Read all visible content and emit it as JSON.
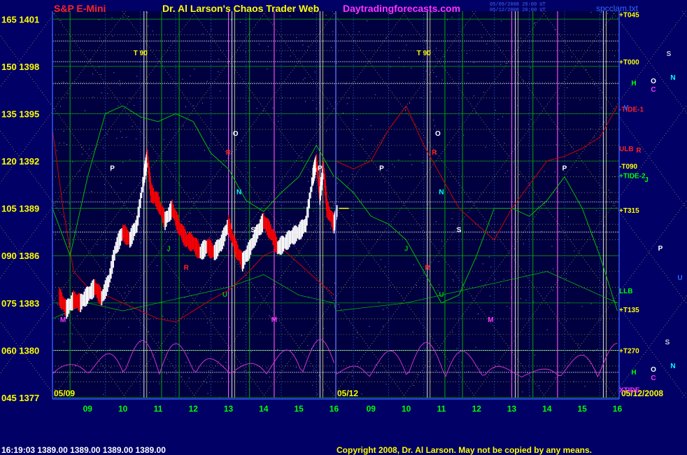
{
  "header": {
    "instrument": "S&P E-Mini",
    "title": "Dr. Al Larson's Chaos Trader Web",
    "site": "Daytradingforecasts.com",
    "timestamp_1": "05/09/2008 20:00 UT",
    "timestamp_2": "05/12/2008 20:00 UT",
    "file": "spcclam.txt"
  },
  "footer": {
    "quote": "16:19:03  1389.00 1389.00 1389.00 1389.00",
    "copyright": "Copyright 2008, Dr. Al Larson. May not be copied by any means."
  },
  "colors": {
    "background": "#000066",
    "plot_bg": "#000040",
    "grid_green": "#00aa00",
    "grid_yellow": "#bbbb55",
    "price_up": "#ffffff",
    "price_down": "#ff0000",
    "red_line": "#cc0000",
    "green_line": "#00bb00",
    "magenta_line": "#cc33cc",
    "label_yellow": "#ffff00",
    "label_magenta": "#ff33ff",
    "label_red": "#ff2222"
  },
  "chart_data": {
    "type": "line",
    "y_left_labels": [
      "165 1401",
      "150 1398",
      "135 1395",
      "120 1392",
      "105 1389",
      "090 1386",
      "075 1383",
      "060 1380",
      "045 1377"
    ],
    "ylim": [
      1377,
      1401.5
    ],
    "x_sessions": [
      {
        "date": "05/09",
        "hours": [
          "09",
          "10",
          "11",
          "12",
          "13",
          "14",
          "15",
          "16"
        ]
      },
      {
        "date": "05/12",
        "hours": [
          "09",
          "10",
          "11",
          "12",
          "13",
          "14",
          "15",
          "16"
        ]
      }
    ],
    "x_last_label": "05/12/2008",
    "price_series": [
      {
        "t": 8.2,
        "v": 1383.4
      },
      {
        "t": 8.4,
        "v": 1382.6
      },
      {
        "t": 8.6,
        "v": 1383.2
      },
      {
        "t": 8.8,
        "v": 1383.0
      },
      {
        "t": 9.0,
        "v": 1383.5
      },
      {
        "t": 9.2,
        "v": 1384.0
      },
      {
        "t": 9.4,
        "v": 1383.3
      },
      {
        "t": 9.6,
        "v": 1384.4
      },
      {
        "t": 9.8,
        "v": 1386.5
      },
      {
        "t": 10.0,
        "v": 1387.5
      },
      {
        "t": 10.2,
        "v": 1387.0
      },
      {
        "t": 10.4,
        "v": 1388.0
      },
      {
        "t": 10.6,
        "v": 1391.0
      },
      {
        "t": 10.7,
        "v": 1392.3
      },
      {
        "t": 10.8,
        "v": 1390.0
      },
      {
        "t": 11.0,
        "v": 1389.4
      },
      {
        "t": 11.2,
        "v": 1388.2
      },
      {
        "t": 11.4,
        "v": 1389.0
      },
      {
        "t": 11.6,
        "v": 1387.8
      },
      {
        "t": 11.8,
        "v": 1387.0
      },
      {
        "t": 12.0,
        "v": 1386.8
      },
      {
        "t": 12.2,
        "v": 1386.2
      },
      {
        "t": 12.4,
        "v": 1386.6
      },
      {
        "t": 12.6,
        "v": 1386.2
      },
      {
        "t": 12.8,
        "v": 1386.8
      },
      {
        "t": 13.0,
        "v": 1388.0
      },
      {
        "t": 13.2,
        "v": 1386.5
      },
      {
        "t": 13.4,
        "v": 1385.6
      },
      {
        "t": 13.6,
        "v": 1386.4
      },
      {
        "t": 13.8,
        "v": 1387.4
      },
      {
        "t": 14.0,
        "v": 1388.2
      },
      {
        "t": 14.2,
        "v": 1387.5
      },
      {
        "t": 14.4,
        "v": 1386.5
      },
      {
        "t": 14.6,
        "v": 1386.8
      },
      {
        "t": 14.8,
        "v": 1387.2
      },
      {
        "t": 15.0,
        "v": 1387.5
      },
      {
        "t": 15.2,
        "v": 1388.0
      },
      {
        "t": 15.4,
        "v": 1391.0
      },
      {
        "t": 15.5,
        "v": 1392.0
      },
      {
        "t": 15.6,
        "v": 1389.8
      },
      {
        "t": 15.7,
        "v": 1391.6
      },
      {
        "t": 15.8,
        "v": 1389.0
      },
      {
        "t": 16.0,
        "v": 1388.0
      },
      {
        "t": 16.1,
        "v": 1389.0
      }
    ],
    "current_price": 1389.0,
    "white_vlines": [
      10.6,
      13.1,
      15.6,
      28.6,
      31.1,
      33.6
    ],
    "magenta_vlines": [
      13.0,
      14.3,
      31.0,
      32.3
    ],
    "green_vlines": [
      8.5,
      11.1,
      11.6,
      13.6,
      29.1,
      29.6,
      31.6
    ],
    "white_hlines": [
      1399.6,
      1398.3,
      1396.9,
      1389.4,
      1387.5,
      1380.0,
      1378.6
    ],
    "annotations_left": [
      {
        "text": "T 90",
        "color": "#ffff00",
        "t": 10.5,
        "v": 1398.7
      },
      {
        "text": "P",
        "color": "#ffffff",
        "t": 9.7,
        "v": 1391.4
      },
      {
        "text": "O",
        "color": "#ffffff",
        "t": 13.2,
        "v": 1393.6
      },
      {
        "text": "R",
        "color": "#ff2222",
        "t": 13.0,
        "v": 1392.4
      },
      {
        "text": "N",
        "color": "#00ffff",
        "t": 13.3,
        "v": 1389.9
      },
      {
        "text": "J",
        "color": "#00bb00",
        "t": 11.3,
        "v": 1386.3
      },
      {
        "text": "R",
        "color": "#ff2222",
        "t": 11.8,
        "v": 1385.1
      },
      {
        "text": "S",
        "color": "#ffffff",
        "t": 13.7,
        "v": 1387.5
      },
      {
        "text": "U",
        "color": "#00bb00",
        "t": 12.9,
        "v": 1383.4
      },
      {
        "text": "M",
        "color": "#ff33ff",
        "t": 8.3,
        "v": 1381.8
      },
      {
        "text": "M",
        "color": "#ff33ff",
        "t": 14.3,
        "v": 1381.8
      },
      {
        "text": "P",
        "color": "#ffffff",
        "t": 15.6,
        "v": 1391.4
      }
    ],
    "annotations_right": [
      {
        "text": "T 90",
        "color": "#ffff00",
        "t": 28.5,
        "v": 1398.7
      },
      {
        "text": "P",
        "color": "#ffffff",
        "t": 27.3,
        "v": 1391.4
      },
      {
        "text": "O",
        "color": "#ffffff",
        "t": 28.9,
        "v": 1393.6
      },
      {
        "text": "R",
        "color": "#ff2222",
        "t": 28.8,
        "v": 1392.4
      },
      {
        "text": "N",
        "color": "#00ffff",
        "t": 29.0,
        "v": 1389.9
      },
      {
        "text": "J",
        "color": "#00bb00",
        "t": 28.0,
        "v": 1386.3
      },
      {
        "text": "R",
        "color": "#ff2222",
        "t": 28.6,
        "v": 1385.1
      },
      {
        "text": "S",
        "color": "#ffffff",
        "t": 29.5,
        "v": 1387.5
      },
      {
        "text": "U",
        "color": "#00bb00",
        "t": 29.0,
        "v": 1383.4
      },
      {
        "text": "M",
        "color": "#ff33ff",
        "t": 30.4,
        "v": 1381.8
      },
      {
        "text": "P",
        "color": "#ffffff",
        "t": 32.5,
        "v": 1391.4
      }
    ],
    "right_axis_labels": [
      {
        "text": "+T045",
        "color": "#ffff00",
        "v": 1401.3
      },
      {
        "text": "+T000",
        "color": "#ffff00",
        "v": 1398.3
      },
      {
        "text": "-TIDE-1",
        "color": "#ff2222",
        "v": 1395.3
      },
      {
        "text": "ULB",
        "color": "#ff2222",
        "v": 1392.8
      },
      {
        "text": "-T090",
        "color": "#ffff00",
        "v": 1391.7
      },
      {
        "text": "+TIDE-2",
        "color": "#00ff00",
        "v": 1391.1
      },
      {
        "text": "+T315",
        "color": "#ffff00",
        "v": 1388.9
      },
      {
        "text": "LLB",
        "color": "#00ff00",
        "v": 1383.8
      },
      {
        "text": "+T135",
        "color": "#ffff00",
        "v": 1382.6
      },
      {
        "text": "+T270",
        "color": "#ffff00",
        "v": 1380.0
      },
      {
        "text": "XTIDE",
        "color": "#ff33ff",
        "v": 1377.5
      }
    ],
    "side_letters": [
      {
        "text": "S",
        "color": "#cccccc",
        "x": 956,
        "y": 80
      },
      {
        "text": "H",
        "color": "#00ff00",
        "x": 906,
        "y": 122
      },
      {
        "text": "O",
        "color": "#ffffff",
        "x": 934,
        "y": 119
      },
      {
        "text": "N",
        "color": "#00ffff",
        "x": 962,
        "y": 114
      },
      {
        "text": "C",
        "color": "#ff33ff",
        "x": 934,
        "y": 131
      },
      {
        "text": "V",
        "color": "#3366ff",
        "x": 895,
        "y": 157
      },
      {
        "text": "R",
        "color": "#ff2222",
        "x": 913,
        "y": 218
      },
      {
        "text": "J",
        "color": "#00ff00",
        "x": 924,
        "y": 260
      },
      {
        "text": "P",
        "color": "#ffffff",
        "x": 944,
        "y": 358
      },
      {
        "text": "U",
        "color": "#3366ff",
        "x": 972,
        "y": 400
      },
      {
        "text": "S",
        "color": "#cccccc",
        "x": 954,
        "y": 492
      },
      {
        "text": "N",
        "color": "#00ffff",
        "x": 962,
        "y": 526
      },
      {
        "text": "H",
        "color": "#00ff00",
        "x": 906,
        "y": 535
      },
      {
        "text": "O",
        "color": "#ffffff",
        "x": 934,
        "y": 531
      },
      {
        "text": "C",
        "color": "#ff33ff",
        "x": 934,
        "y": 543
      }
    ]
  }
}
